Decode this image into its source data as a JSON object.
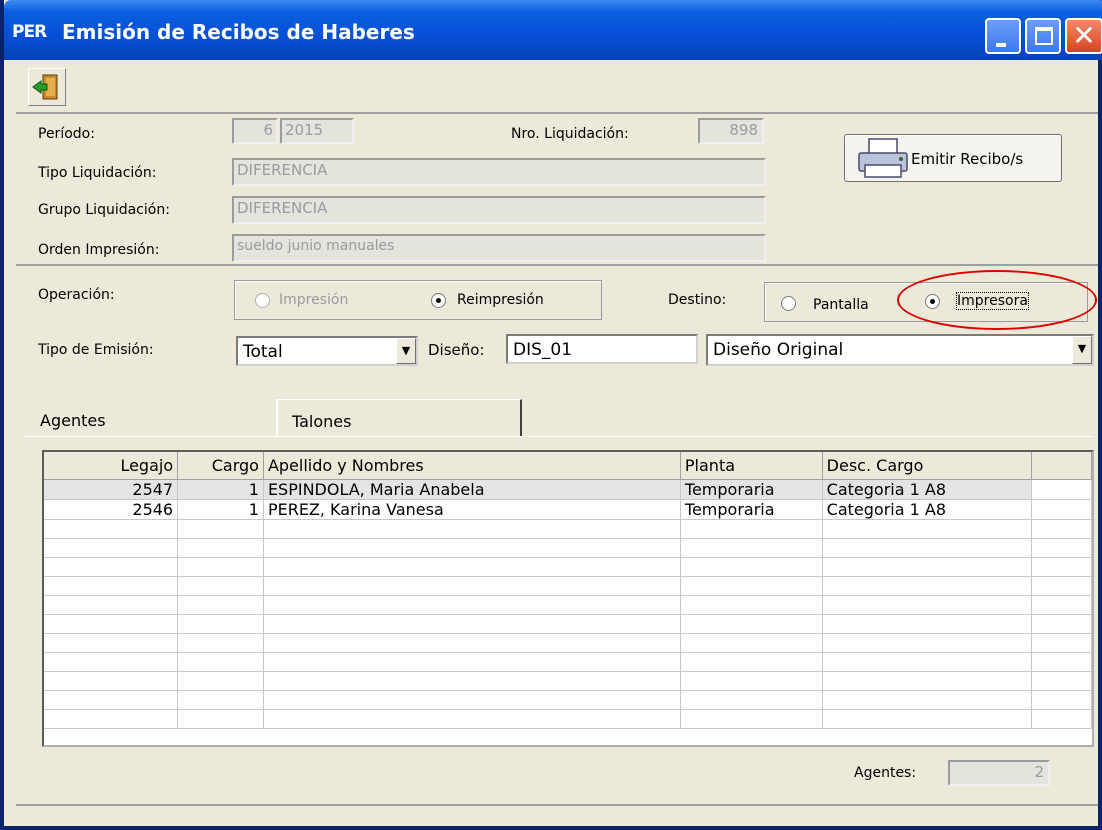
{
  "window": {
    "app_badge": "PER",
    "title": "Emisión de Recibos de Haberes"
  },
  "toolbar": {
    "exit_icon": "exit-door-icon"
  },
  "form": {
    "periodo_label": "Período:",
    "periodo_mes": "6",
    "periodo_anio": "2015",
    "nro_liq_label": "Nro. Liquidación:",
    "nro_liq_value": "898",
    "tipo_liq_label": "Tipo Liquidación:",
    "tipo_liq_value": "DIFERENCIA",
    "grupo_liq_label": "Grupo Liquidación:",
    "grupo_liq_value": "DIFERENCIA",
    "orden_label": "Orden Impresión:",
    "orden_value": "sueldo junio manuales",
    "emit_button": "Emitir Recibo/s",
    "operacion_label": "Operación:",
    "op_impresion": "Impresión",
    "op_reimpresion": "Reimpresión",
    "destino_label": "Destino:",
    "dest_pantalla": "Pantalla",
    "dest_impresora": "Impresora",
    "tipo_emision_label": "Tipo de Emisión:",
    "tipo_emision_value": "Total",
    "diseno_label": "Diseño:",
    "diseno_code": "DIS_01",
    "diseno_desc": "Diseño Original"
  },
  "tabs": [
    "Agentes",
    "Talones"
  ],
  "grid": {
    "columns": [
      "Legajo",
      "Cargo",
      "Apellido y Nombres",
      "Planta",
      "Desc. Cargo"
    ],
    "rows": [
      [
        "2547",
        "1",
        "ESPINDOLA, Maria Anabela",
        "Temporaria",
        "Categoria 1 A8"
      ],
      [
        "2546",
        "1",
        "PEREZ, Karina Vanesa",
        "Temporaria",
        "Categoria 1 A8"
      ]
    ]
  },
  "footer": {
    "agentes_label": "Agentes:",
    "agentes_count": "2"
  },
  "colors": {
    "titlebar": "#0550d7",
    "highlight": "#e00000"
  }
}
